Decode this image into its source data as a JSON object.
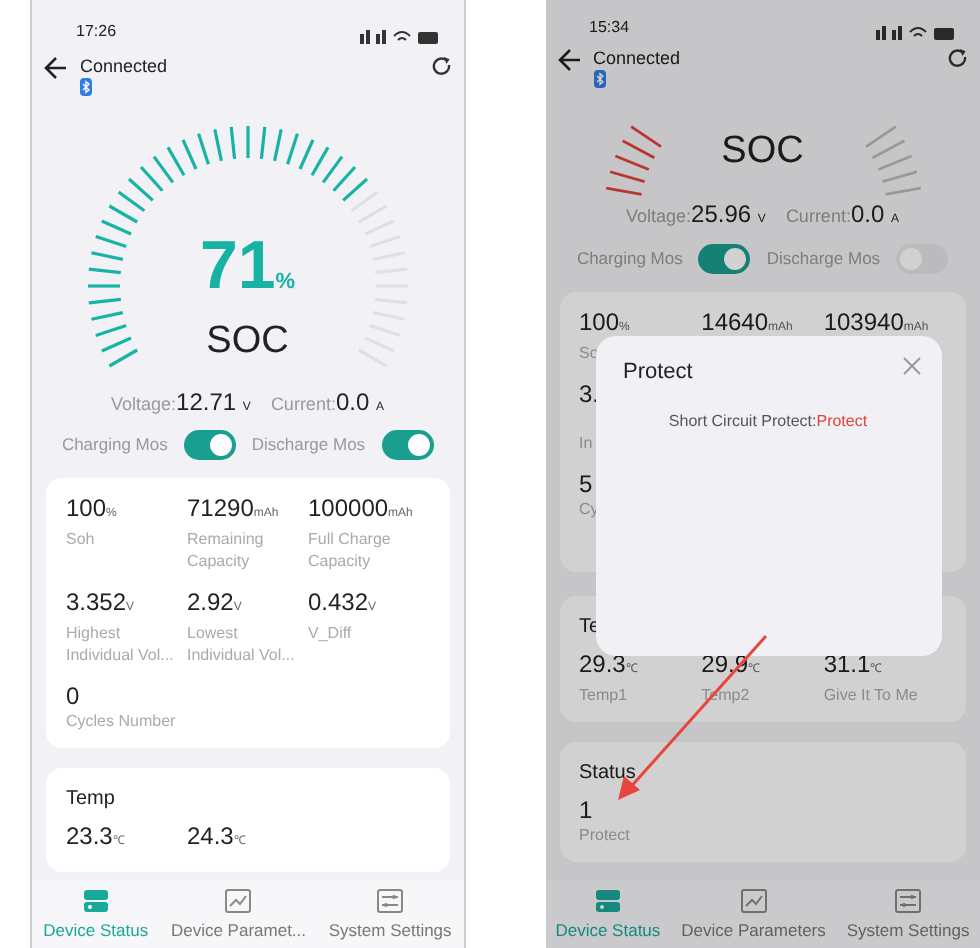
{
  "phones": [
    {
      "status_bar": {
        "time": "17:26"
      },
      "header": {
        "title": "Connected"
      },
      "gauge": {
        "level": 0.71,
        "alarm": false,
        "value": "71",
        "unit": "%",
        "label": "SOC"
      },
      "readings": [
        {
          "label": "Voltage:",
          "value": "12.71",
          "unit": "V"
        },
        {
          "label": "Current:",
          "value": "0.0",
          "unit": "A"
        }
      ],
      "switches": [
        {
          "label": "Charging Mos",
          "on": true
        },
        {
          "label": "Discharge Mos",
          "on": true
        }
      ],
      "cards": [
        {
          "rows": [
            [
              {
                "value": "100",
                "unit": "%",
                "label": "Soh"
              },
              {
                "value": "71290",
                "unit": "mAh",
                "label": "Remaining Capacity"
              },
              {
                "value": "100000",
                "unit": "mAh",
                "label": "Full Charge Capacity"
              }
            ],
            [
              {
                "value": "3.352",
                "unit": "V",
                "label": "Highest Individual Vol..."
              },
              {
                "value": "2.92",
                "unit": "V",
                "label": "Lowest Individual Vol..."
              },
              {
                "value": "0.432",
                "unit": "V",
                "label": "V_Diff"
              }
            ],
            [
              {
                "value": "0",
                "label": "Cycles Number"
              }
            ]
          ]
        },
        {
          "title": "Temp",
          "rows": [
            [
              {
                "value": "23.3",
                "unit": "℃"
              },
              {
                "value": "24.3",
                "unit": "℃"
              }
            ]
          ]
        }
      ],
      "nav": [
        {
          "label": "Device Status",
          "selected": true
        },
        {
          "label": "Device Paramet...",
          "selected": false
        },
        {
          "label": "System Settings",
          "selected": false
        }
      ]
    },
    {
      "status_bar": {
        "time": "15:34"
      },
      "header": {
        "title": "Connected"
      },
      "gauge": {
        "alarm": true,
        "label": "SOC"
      },
      "readings": [
        {
          "label": "Voltage:",
          "value": "25.96",
          "unit": "V"
        },
        {
          "label": "Current:",
          "value": "0.0",
          "unit": "A"
        }
      ],
      "switches": [
        {
          "label": "Charging Mos",
          "on": true
        },
        {
          "label": "Discharge Mos",
          "on": false
        }
      ],
      "cards": [
        {
          "rows": [
            [
              {
                "value": "100",
                "unit": "%",
                "label": "So"
              },
              {
                "value": "14640",
                "unit": "mAh"
              },
              {
                "value": "103940",
                "unit": "mAh"
              }
            ],
            [
              {
                "value": "3.",
                "label": "In"
              }
            ],
            [
              {
                "value": "5",
                "label": "Cy"
              }
            ]
          ]
        },
        {
          "title": "Te",
          "rows": [
            [
              {
                "value": "29.3",
                "unit": "℃",
                "label": "Temp1"
              },
              {
                "value": "29.9",
                "unit": "℃",
                "label": "Temp2"
              },
              {
                "value": "31.1",
                "unit": "℃",
                "label": "Give It To Me"
              }
            ]
          ]
        },
        {
          "title": "Status",
          "rows": [
            [
              {
                "value": "1",
                "label": "Protect"
              }
            ]
          ]
        }
      ],
      "nav": [
        {
          "label": "Device Status",
          "selected": true
        },
        {
          "label": "Device Parameters",
          "selected": false
        },
        {
          "label": "System Settings",
          "selected": false
        }
      ],
      "dialog": {
        "title": "Protect",
        "message": "Short Circuit Protect:",
        "status": "Protect"
      },
      "annotations": [
        {
          "kind": "arrow"
        }
      ]
    }
  ]
}
